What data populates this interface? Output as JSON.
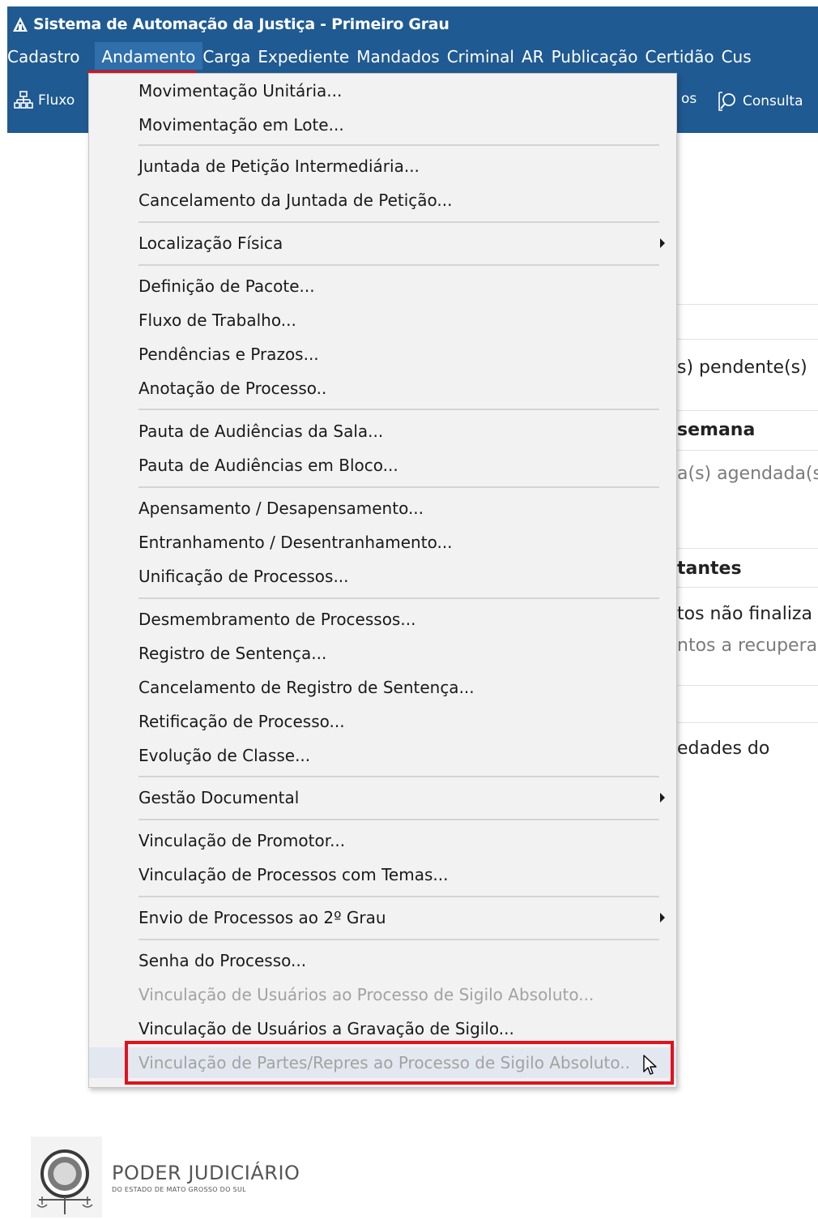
{
  "window": {
    "title": "Sistema de Automação da Justiça - Primeiro Grau"
  },
  "menubar": {
    "items": [
      "Cadastro",
      "Andamento",
      "Carga",
      "Expediente",
      "Mandados",
      "Criminal",
      "AR",
      "Publicação",
      "Certidão",
      "Cus"
    ],
    "active": "Andamento"
  },
  "toolbar": {
    "left_label": "Fluxo",
    "right_partial": "os",
    "consulta_label": "Consulta"
  },
  "background": {
    "pendente": "s) pendente(s)",
    "semana": "semana",
    "agendada": "a(s) agendada(s",
    "tantes": "tantes",
    "nao_finaliza": "tos não finaliza",
    "recupera": "ntos a recupera",
    "edades": "edades do"
  },
  "dropdown": {
    "items": [
      {
        "label": "Movimentação Unitária...",
        "submenu": false,
        "disabled": false
      },
      {
        "label": "Movimentação em Lote...",
        "submenu": false,
        "disabled": false
      },
      {
        "label": "Juntada de Petição Intermediária...",
        "submenu": false,
        "disabled": false
      },
      {
        "label": "Cancelamento da Juntada de Petição...",
        "submenu": false,
        "disabled": false
      },
      {
        "label": "Localização Física",
        "submenu": true,
        "disabled": false
      },
      {
        "label": "Definição de Pacote...",
        "submenu": false,
        "disabled": false
      },
      {
        "label": "Fluxo de Trabalho...",
        "submenu": false,
        "disabled": false
      },
      {
        "label": "Pendências e Prazos...",
        "submenu": false,
        "disabled": false
      },
      {
        "label": "Anotação de Processo..",
        "submenu": false,
        "disabled": false
      },
      {
        "label": "Pauta de Audiências da Sala...",
        "submenu": false,
        "disabled": false
      },
      {
        "label": "Pauta de Audiências em Bloco...",
        "submenu": false,
        "disabled": false
      },
      {
        "label": "Apensamento / Desapensamento...",
        "submenu": false,
        "disabled": false
      },
      {
        "label": "Entranhamento / Desentranhamento...",
        "submenu": false,
        "disabled": false
      },
      {
        "label": "Unificação de Processos...",
        "submenu": false,
        "disabled": false
      },
      {
        "label": "Desmembramento de Processos...",
        "submenu": false,
        "disabled": false
      },
      {
        "label": "Registro de Sentença...",
        "submenu": false,
        "disabled": false
      },
      {
        "label": "Cancelamento de Registro de Sentença...",
        "submenu": false,
        "disabled": false
      },
      {
        "label": "Retificação de Processo...",
        "submenu": false,
        "disabled": false
      },
      {
        "label": "Evolução de Classe...",
        "submenu": false,
        "disabled": false
      },
      {
        "label": "Gestão Documental",
        "submenu": true,
        "disabled": false
      },
      {
        "label": "Vinculação de Promotor...",
        "submenu": false,
        "disabled": false
      },
      {
        "label": "Vinculação de Processos com Temas...",
        "submenu": false,
        "disabled": false
      },
      {
        "label": "Envio de Processos ao 2º Grau",
        "submenu": true,
        "disabled": false
      },
      {
        "label": "Senha do Processo...",
        "submenu": false,
        "disabled": false
      },
      {
        "label": "Vinculação de Usuários ao Processo de Sigilo Absoluto...",
        "submenu": false,
        "disabled": true
      },
      {
        "label": "Vinculação de Usuários a Gravação de Sigilo...",
        "submenu": false,
        "disabled": false
      },
      {
        "label": "Vinculação de Partes/Repres ao Processo de Sigilo Absoluto..",
        "submenu": false,
        "disabled": true
      }
    ]
  },
  "footer": {
    "org_name": "PODER JUDICIÁRIO",
    "org_sub": "DO ESTADO DE MATO GROSSO DO SUL"
  },
  "colors": {
    "brand_blue": "#1f5a92",
    "highlight_red": "#e0121d",
    "menu_bg": "#f2f2f2",
    "disabled_text": "#a2a2a2"
  }
}
